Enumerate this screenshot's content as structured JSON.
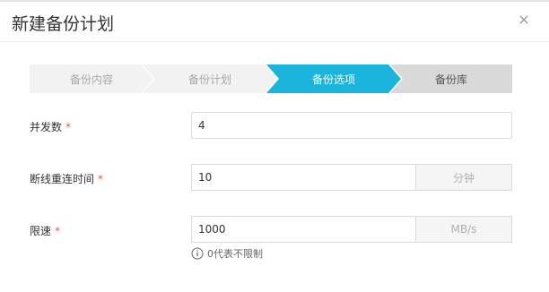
{
  "dialog": {
    "title": "新建备份计划",
    "close_icon": "close-icon"
  },
  "steps": [
    {
      "label": "备份内容",
      "state": "done"
    },
    {
      "label": "备份计划",
      "state": "done"
    },
    {
      "label": "备份选项",
      "state": "active"
    },
    {
      "label": "备份库",
      "state": "pending"
    }
  ],
  "colors": {
    "active_step": "#1ab4dc",
    "done_step": "#f2f2f2",
    "pending_step": "#d9d9d9",
    "required_mark": "#e85a3c"
  },
  "form": {
    "concurrency": {
      "label": "并发数",
      "required": "*",
      "value": "4"
    },
    "reconnect": {
      "label": "断线重连时间",
      "required": "*",
      "value": "10",
      "unit": "分钟"
    },
    "rate_limit": {
      "label": "限速",
      "required": "*",
      "value": "1000",
      "unit": "MB/s",
      "hint": "0代表不限制",
      "hint_icon": "info-icon"
    }
  }
}
